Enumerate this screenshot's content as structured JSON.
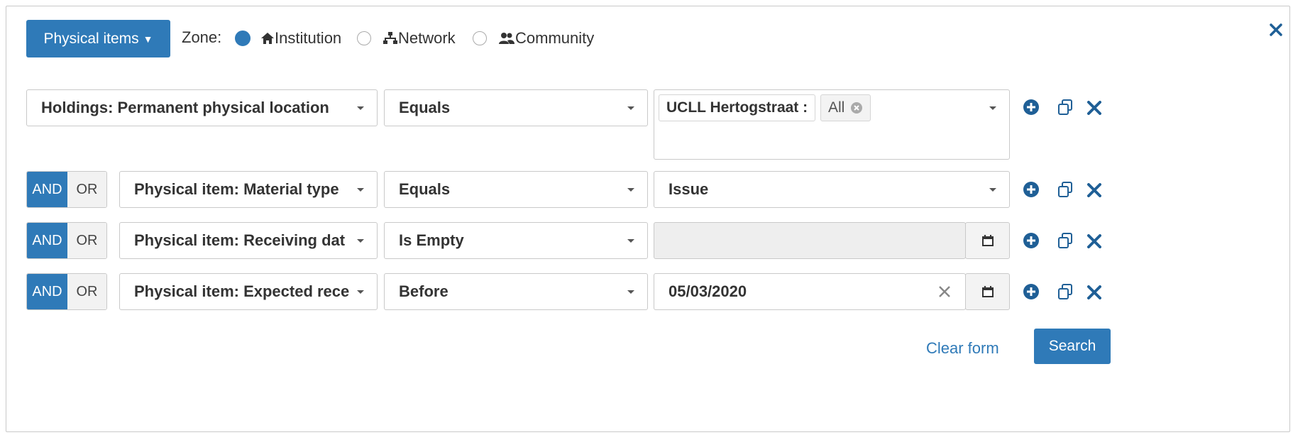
{
  "header": {
    "type_button": "Physical items",
    "zone_label": "Zone:",
    "zones": [
      {
        "label": "Institution",
        "icon": "home-icon",
        "selected": true
      },
      {
        "label": "Network",
        "icon": "network-icon",
        "selected": false
      },
      {
        "label": "Community",
        "icon": "users-icon",
        "selected": false
      }
    ]
  },
  "rows": [
    {
      "connector": null,
      "field": "Holdings: Permanent physical location",
      "operator": "Equals",
      "value_tags": [
        {
          "label": "UCLL Hertogstraat :"
        },
        {
          "label": "All"
        }
      ]
    },
    {
      "connector": {
        "and": "AND",
        "or": "OR",
        "selected": "AND"
      },
      "field": "Physical item: Material type",
      "operator": "Equals",
      "value": "Issue"
    },
    {
      "connector": {
        "and": "AND",
        "or": "OR",
        "selected": "AND"
      },
      "field": "Physical item: Receiving dat",
      "operator": "Is Empty",
      "value": ""
    },
    {
      "connector": {
        "and": "AND",
        "or": "OR",
        "selected": "AND"
      },
      "field": "Physical item: Expected rece",
      "operator": "Before",
      "value": "05/03/2020"
    }
  ],
  "footer": {
    "clear_label": "Clear form",
    "search_label": "Search"
  },
  "colors": {
    "accent": "#2f7ab8",
    "icon": "#1f5f96"
  }
}
